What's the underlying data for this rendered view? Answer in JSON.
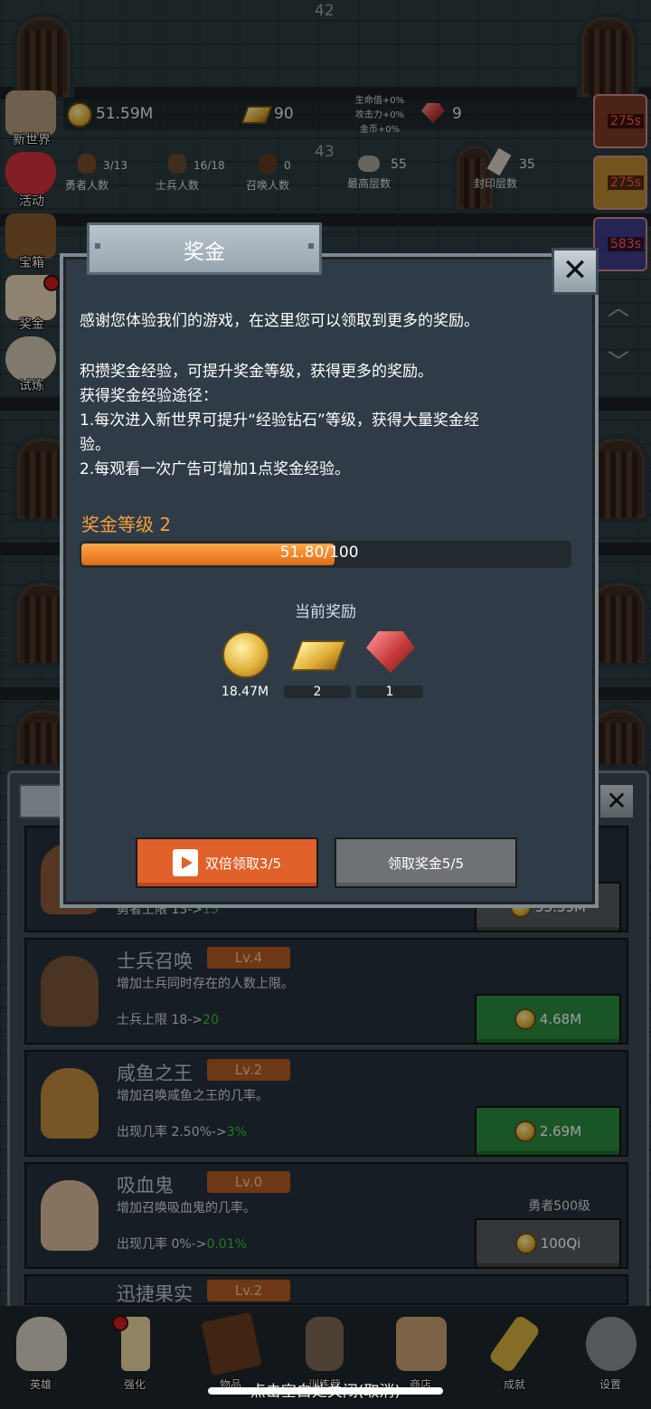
{
  "top": {
    "floor_top": "42",
    "floor_mid": "43",
    "gold": "51.59M",
    "gold_bars": "90",
    "buffs": [
      "生命值+0%",
      "攻击力+0%",
      "金币+0%"
    ],
    "gems": "9",
    "stats": [
      {
        "value": "3/13",
        "label": "勇者人数"
      },
      {
        "value": "16/18",
        "label": "士兵人数"
      },
      {
        "value": "0",
        "label": "召唤人数"
      },
      {
        "value": "55",
        "label": "最高层数"
      },
      {
        "value": "35",
        "label": "封印层数"
      }
    ]
  },
  "side_menu": [
    "新世界",
    "活动",
    "宝箱",
    "奖金",
    "试炼"
  ],
  "timers": [
    "275s",
    "275s",
    "583s"
  ],
  "modal": {
    "title": "奖金",
    "line1": "感谢您体验我们的游戏，在这里您可以领取到更多的奖励。",
    "line2": "积攒奖金经验，可提升奖金等级，获得更多的奖励。",
    "line3": "获得奖金经验途径：",
    "line4": "1.每次进入新世界可提升“经验钻石”等级，获得大量奖金经",
    "line5": "验。",
    "line6": "2.每观看一次广告可增加1点奖金经验。",
    "level_label": "奖金等级 2",
    "xp_current": "51.80",
    "xp_max": "/100",
    "xp_fraction": 0.518,
    "reward_title": "当前奖励",
    "rewards": [
      {
        "icon": "gold-coin-icon",
        "count": "18.47M"
      },
      {
        "icon": "gold-bar-icon",
        "count": "2"
      },
      {
        "icon": "ruby-gem-icon",
        "count": "1"
      }
    ],
    "btn_double": "双倍领取3/5",
    "btn_claim": "领取奖金5/5"
  },
  "list": {
    "rows": [
      {
        "name": "",
        "level": "",
        "desc": "",
        "stat": "勇者上限 13->",
        "stat_new": "15",
        "price": "53.59M",
        "btn": "green"
      },
      {
        "name": "士兵召唤",
        "level": "Lv.4",
        "desc": "增加士兵同时存在的人数上限。",
        "stat": "士兵上限 18->",
        "stat_new": "20",
        "price": "4.68M",
        "btn": "green"
      },
      {
        "name": "咸鱼之王",
        "level": "Lv.2",
        "desc": "增加召唤咸鱼之王的几率。",
        "stat": "出现几率 2.50%->",
        "stat_new": "3%",
        "price": "2.69M",
        "btn": "green"
      },
      {
        "name": "吸血鬼",
        "level": "Lv.0",
        "desc": "增加召唤吸血鬼的几率。",
        "stat": "出现几率 0%->",
        "stat_new": "0.01%",
        "price": "100Qi",
        "btn": "gray",
        "req": "勇者500级"
      },
      {
        "name": "迅捷果实",
        "level": "Lv.2",
        "desc": "",
        "stat": "",
        "stat_new": "",
        "price": "",
        "btn": ""
      }
    ]
  },
  "nav": [
    "英雄",
    "强化",
    "物品",
    "训练营",
    "商店",
    "成就",
    "设置"
  ],
  "hint": "点击空白处关闭(取消)",
  "colors": {
    "accent_orange": "#e0612a",
    "level_orange": "#f5a040",
    "green_button": "#2b8a3f"
  }
}
